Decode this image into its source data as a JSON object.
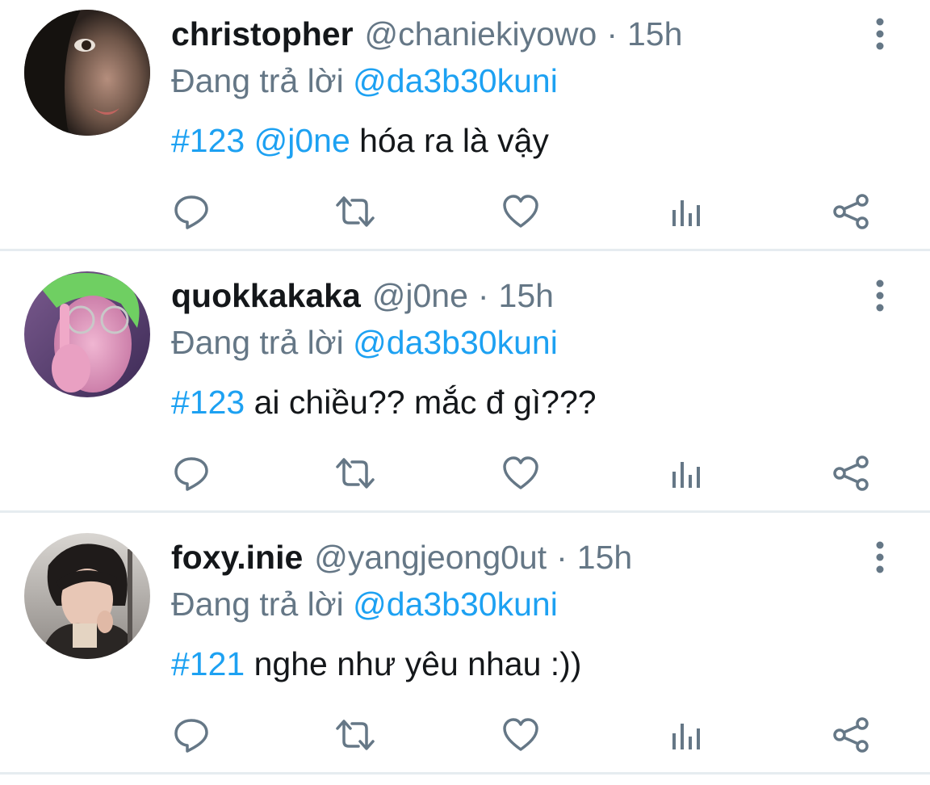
{
  "tweets": [
    {
      "name": "christopher",
      "handle": "@chaniekiyowo",
      "separator": "·",
      "time": "15h",
      "reply_prefix": "Đang trả lời",
      "reply_to": "@da3b30kuni",
      "tags": [
        "#123",
        "@j0ne"
      ],
      "text": "hóa ra là vậy",
      "avatar": "dark-hooded-portrait"
    },
    {
      "name": "quokkakaka",
      "handle": "@j0ne",
      "separator": "·",
      "time": "15h",
      "reply_prefix": "Đang trả lời",
      "reply_to": "@da3b30kuni",
      "tags": [
        "#123"
      ],
      "text": "ai chiều?? mắc đ gì???",
      "avatar": "green-hair-glasses-portrait"
    },
    {
      "name": "foxy.inie",
      "handle": "@yangjeong0ut",
      "separator": "·",
      "time": "15h",
      "reply_prefix": "Đang trả lời",
      "reply_to": "@da3b30kuni",
      "tags": [
        "#121"
      ],
      "text": "nghe như yêu nhau :))",
      "avatar": "dark-hair-jacket-portrait"
    }
  ],
  "action_icons": [
    "reply-icon",
    "retweet-icon",
    "like-icon",
    "analytics-icon",
    "share-icon"
  ],
  "colors": {
    "link": "#1da1f2",
    "muted": "#657786",
    "text": "#14171a",
    "divider": "#e6ecf0"
  }
}
